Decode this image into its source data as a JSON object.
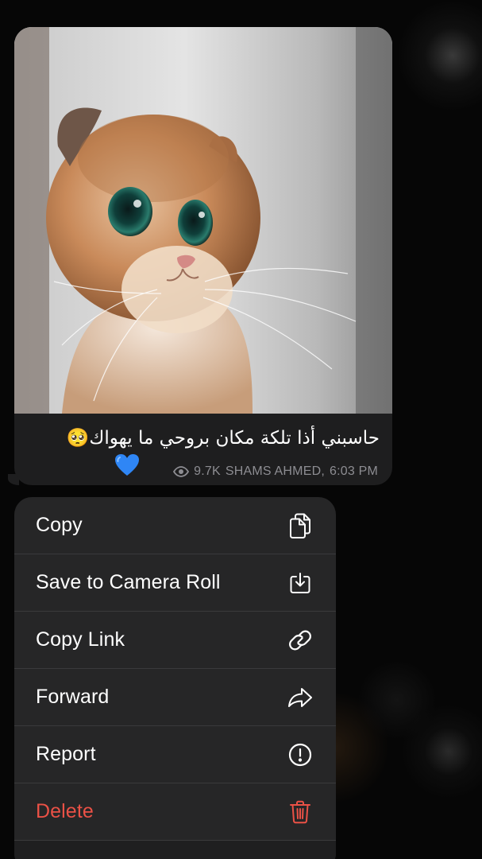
{
  "message": {
    "caption": "حاسبني أذا تلكة مكان بروحي ما يهواك🥺",
    "heart_emoji": "💙",
    "views": "9.7K",
    "author": "SHAMS AHMED",
    "time": "6:03 PM",
    "views_icon": "eye-icon",
    "image_description_icon": "cat-photo"
  },
  "menu": {
    "items": [
      {
        "label": "Copy",
        "icon": "copy-icon"
      },
      {
        "label": "Save to Camera Roll",
        "icon": "download-icon"
      },
      {
        "label": "Copy Link",
        "icon": "link-icon"
      },
      {
        "label": "Forward",
        "icon": "forward-icon"
      },
      {
        "label": "Report",
        "icon": "report-icon"
      },
      {
        "label": "Delete",
        "icon": "trash-icon"
      }
    ]
  },
  "colors": {
    "bubble": "#1e1e1f",
    "menu": "#262627",
    "danger": "#ea5146",
    "meta_text": "#8d8d92",
    "heart_blue": "#2f86f5"
  }
}
